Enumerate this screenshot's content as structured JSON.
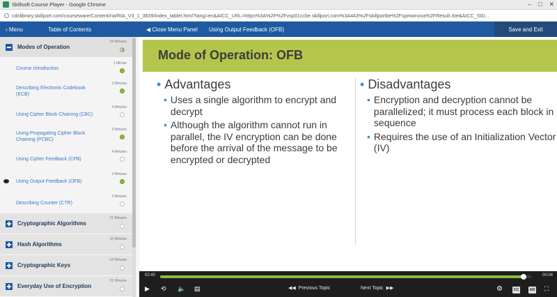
{
  "browser": {
    "window_title": "Skillsoft Course Player - Google Chrome",
    "url": "cdnlibrary.skillport.com/courseware/Content/ria/RIA_V3_1_3839/index_tablet.html?lang=en&AICC_URL=https%3A%2F%2Fvsp01ccbe.skillport.com%3A443%2Fskillportbe%2Fspmwnova%2FResult.rbe&AICC_SID..."
  },
  "sidebar": {
    "menu_label": "Menu",
    "toc_label": "Table of Contents",
    "sections": [
      {
        "title": "Modes of Operation",
        "duration": "24 Minutes",
        "status": "in-progress",
        "items": [
          {
            "title": "Course Introduction",
            "duration": "1 Minute",
            "status": "done"
          },
          {
            "title": "Describing Electronic Codebook (ECB)",
            "duration": "3 Minutes",
            "status": "done"
          },
          {
            "title": "Using Cipher Block Chaining (CBC)",
            "duration": "4 Minutes",
            "status": "not-started"
          },
          {
            "title": "Using Propagating Cipher Block Chaining (PCBC)",
            "duration": "3 Minutes",
            "status": "done"
          },
          {
            "title": "Using Cipher Feedback (CFB)",
            "duration": "4 Minutes",
            "status": "not-started"
          },
          {
            "title": "Using Output Feedback (OFB)",
            "duration": "3 Minutes",
            "status": "done"
          },
          {
            "title": "Describing Counter (CTR)",
            "duration": "3 Minutes",
            "status": "not-started"
          }
        ]
      },
      {
        "title": "Cryptographic Algorithms",
        "duration": "21 Minutes",
        "status": "not-started"
      },
      {
        "title": "Hash Algorithms",
        "duration": "10 Minutes",
        "status": "not-started"
      },
      {
        "title": "Cryptographic Keys",
        "duration": "14 Minutes",
        "status": "not-started"
      },
      {
        "title": "Everyday Use of Encryption",
        "duration": "21 Minutes",
        "status": "not-started"
      }
    ]
  },
  "topbar": {
    "close_panel_label": "Close Menu Panel",
    "current_topic": "Using Output Feedback (OFB)",
    "save_exit_label": "Save and Exit"
  },
  "slide": {
    "title": "Mode of Operation: OFB",
    "advantages": {
      "heading": "Advantages",
      "points": [
        "Uses a single algorithm to encrypt and decrypt",
        "Although the algorithm cannot run in parallel, the IV encryption can be done before the arrival of the  message to be encrypted or decrypted"
      ]
    },
    "disadvantages": {
      "heading": "Disadvantages",
      "points": [
        "Encryption and decryption cannot be parallelized; it must process each block in sequence",
        "Requires the use of an Initialization Vector (IV)"
      ]
    }
  },
  "player": {
    "elapsed": "02:40",
    "remaining": "00:04",
    "progress_fraction": 0.98,
    "previous_label": "Previous Topic",
    "next_label": "Next Topic",
    "cc_label": "CC",
    "ad_label": "AD",
    "colors": {
      "progress": "#8cbb3a",
      "bar": "#1e1e1e",
      "brand": "#1f5aa1",
      "slide_header": "#b4c54b"
    }
  }
}
